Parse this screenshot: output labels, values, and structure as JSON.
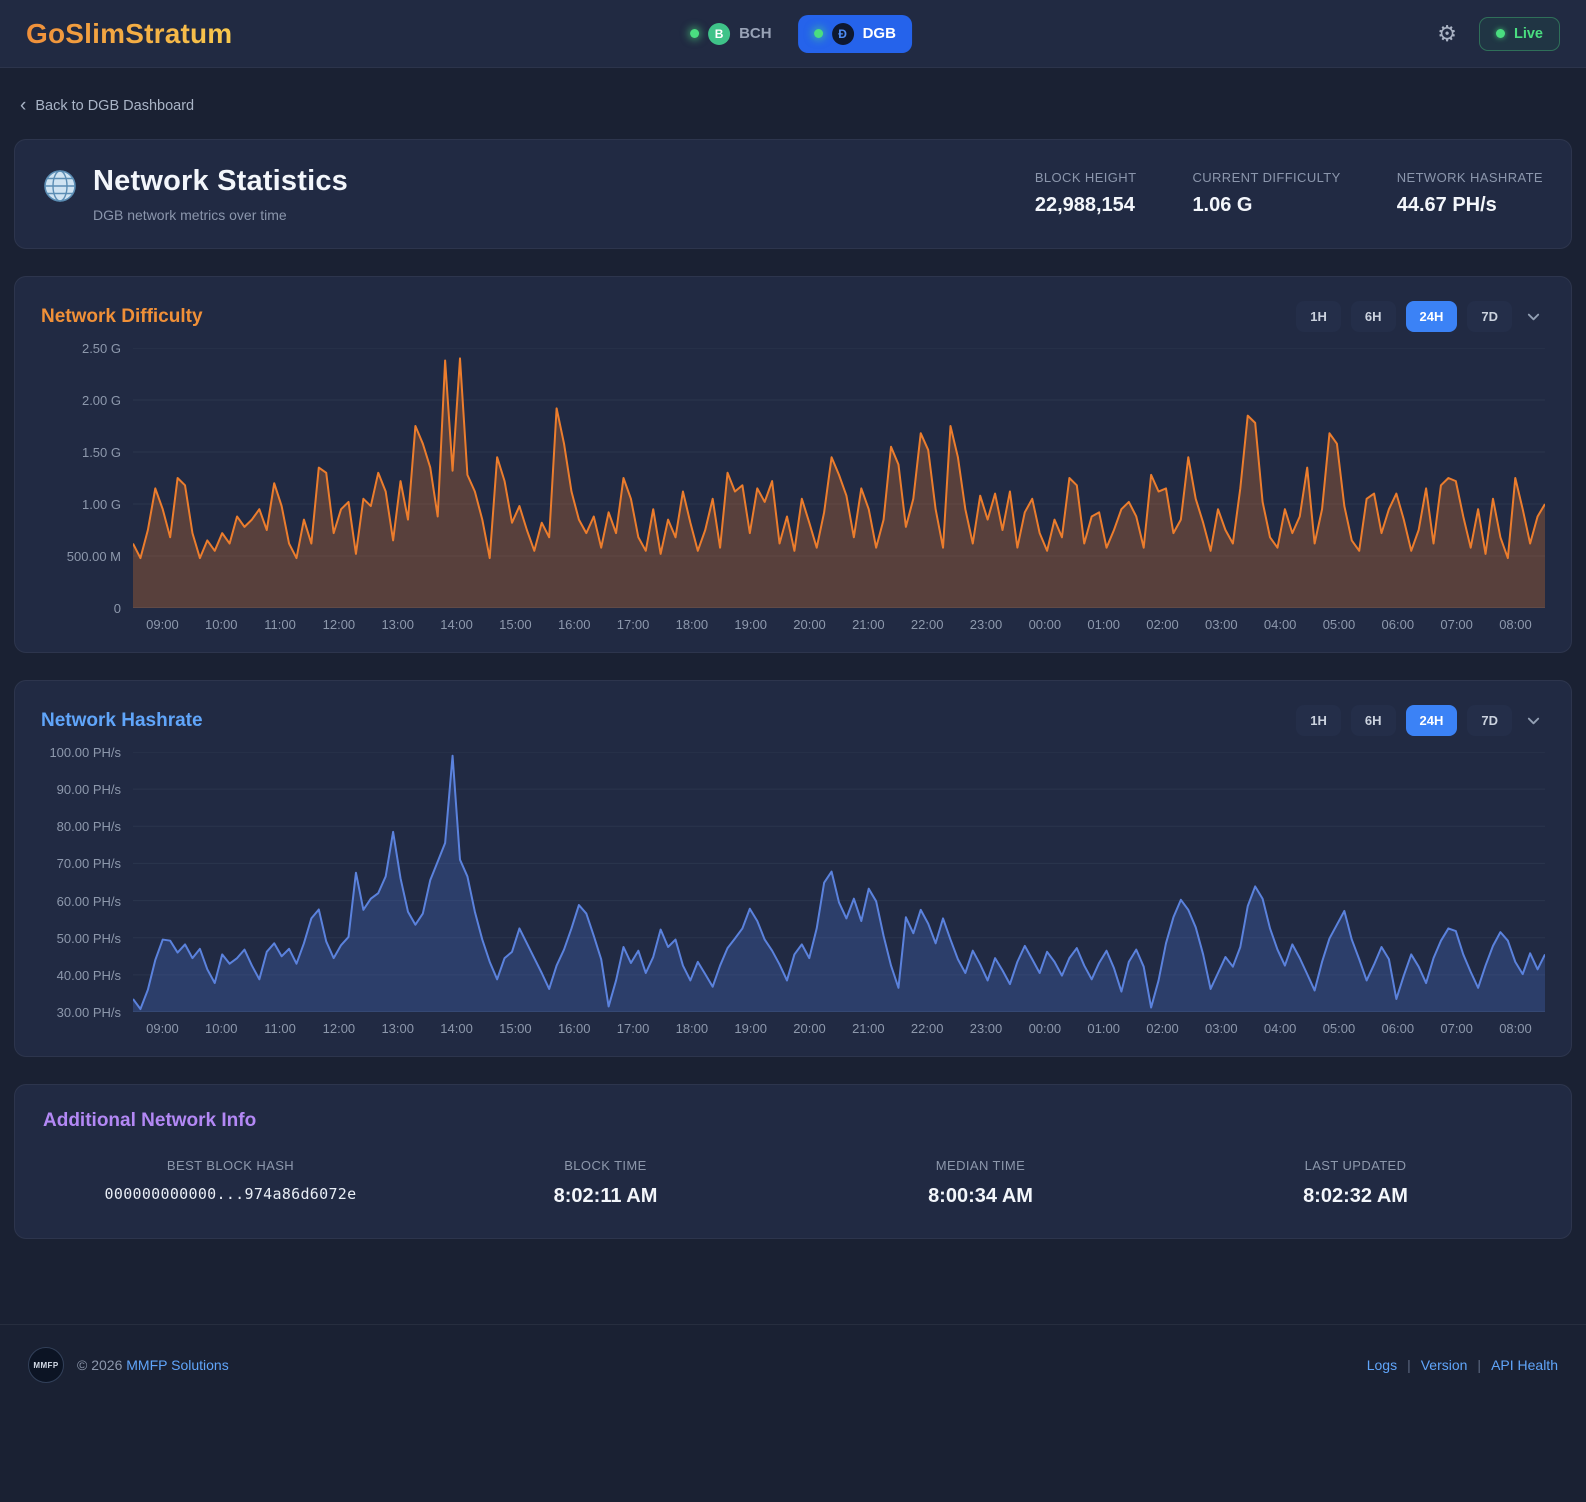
{
  "header": {
    "logo": "GoSlimStratum",
    "coins": [
      {
        "label": "BCH",
        "active": false
      },
      {
        "label": "DGB",
        "active": true
      }
    ],
    "live_label": "Live"
  },
  "breadcrumb": {
    "back_label": "Back to DGB Dashboard"
  },
  "stats_card": {
    "title": "Network Statistics",
    "subtitle": "DGB network metrics over time",
    "stats": [
      {
        "label": "BLOCK HEIGHT",
        "value": "22,988,154"
      },
      {
        "label": "CURRENT DIFFICULTY",
        "value": "1.06 G"
      },
      {
        "label": "NETWORK HASHRATE",
        "value": "44.67 PH/s"
      }
    ]
  },
  "time_ranges": [
    "1H",
    "6H",
    "24H",
    "7D"
  ],
  "active_range": "24H",
  "colors": {
    "accent_blue": "#3b82f6",
    "difficulty_orange": "#ec7d2d",
    "hashrate_blue": "#5b82dd",
    "live_green": "#4ade80",
    "purple": "#b388f5"
  },
  "chart_data": [
    {
      "id": "difficulty",
      "type": "area",
      "title": "Network Difficulty",
      "title_color": "#f09038",
      "line_color": "#ec7d2d",
      "fill_color": "rgba(236,125,45,0.27)",
      "ylabel_unit": "G",
      "ylim": [
        0,
        2.5
      ],
      "y_ticks": [
        {
          "v": 0,
          "label": "0"
        },
        {
          "v": 0.5,
          "label": "500.00 M"
        },
        {
          "v": 1,
          "label": "1.00 G"
        },
        {
          "v": 1.5,
          "label": "1.50 G"
        },
        {
          "v": 2,
          "label": "2.00 G"
        },
        {
          "v": 2.5,
          "label": "2.50 G"
        }
      ],
      "x_ticks": [
        "09:00",
        "10:00",
        "11:00",
        "12:00",
        "13:00",
        "14:00",
        "15:00",
        "16:00",
        "17:00",
        "18:00",
        "19:00",
        "20:00",
        "21:00",
        "22:00",
        "23:00",
        "00:00",
        "01:00",
        "02:00",
        "03:00",
        "04:00",
        "05:00",
        "06:00",
        "07:00",
        "08:00"
      ],
      "values": [
        0.62,
        0.48,
        0.75,
        1.15,
        0.95,
        0.68,
        1.25,
        1.18,
        0.72,
        0.48,
        0.65,
        0.55,
        0.72,
        0.62,
        0.88,
        0.78,
        0.85,
        0.95,
        0.75,
        1.2,
        0.98,
        0.62,
        0.48,
        0.85,
        0.62,
        1.35,
        1.3,
        0.72,
        0.95,
        1.02,
        0.52,
        1.05,
        0.98,
        1.3,
        1.12,
        0.65,
        1.22,
        0.85,
        1.75,
        1.58,
        1.35,
        0.88,
        2.38,
        1.32,
        2.4,
        1.28,
        1.12,
        0.85,
        0.48,
        1.45,
        1.22,
        0.82,
        0.98,
        0.75,
        0.55,
        0.82,
        0.68,
        1.92,
        1.58,
        1.12,
        0.85,
        0.72,
        0.88,
        0.58,
        0.92,
        0.72,
        1.25,
        1.05,
        0.68,
        0.55,
        0.95,
        0.52,
        0.85,
        0.68,
        1.12,
        0.82,
        0.55,
        0.75,
        1.05,
        0.58,
        1.3,
        1.12,
        1.18,
        0.72,
        1.15,
        1.02,
        1.22,
        0.62,
        0.88,
        0.55,
        1.05,
        0.82,
        0.58,
        0.92,
        1.45,
        1.28,
        1.08,
        0.68,
        1.15,
        0.95,
        0.58,
        0.85,
        1.55,
        1.38,
        0.78,
        1.05,
        1.68,
        1.52,
        0.95,
        0.58,
        1.75,
        1.45,
        0.95,
        0.62,
        1.08,
        0.85,
        1.1,
        0.75,
        1.12,
        0.58,
        0.92,
        1.05,
        0.72,
        0.55,
        0.85,
        0.68,
        1.25,
        1.18,
        0.62,
        0.88,
        0.92,
        0.58,
        0.75,
        0.95,
        1.02,
        0.88,
        0.58,
        1.28,
        1.12,
        1.15,
        0.72,
        0.85,
        1.45,
        1.05,
        0.82,
        0.55,
        0.95,
        0.75,
        0.62,
        1.15,
        1.85,
        1.78,
        1.02,
        0.68,
        0.58,
        0.95,
        0.72,
        0.88,
        1.35,
        0.62,
        0.95,
        1.68,
        1.58,
        0.98,
        0.65,
        0.55,
        1.05,
        1.1,
        0.72,
        0.95,
        1.1,
        0.85,
        0.55,
        0.75,
        1.15,
        0.62,
        1.18,
        1.25,
        1.22,
        0.88,
        0.58,
        0.95,
        0.52,
        1.05,
        0.68,
        0.48,
        1.25,
        0.95,
        0.62,
        0.88,
        1.0
      ]
    },
    {
      "id": "hashrate",
      "type": "area",
      "title": "Network Hashrate",
      "title_color": "#60a5fa",
      "line_color": "#5b82dd",
      "fill_color": "rgba(75,114,209,0.28)",
      "ylabel_unit": "PH/s",
      "ylim": [
        30,
        100
      ],
      "y_ticks": [
        {
          "v": 30,
          "label": "30.00 PH/s"
        },
        {
          "v": 40,
          "label": "40.00 PH/s"
        },
        {
          "v": 50,
          "label": "50.00 PH/s"
        },
        {
          "v": 60,
          "label": "60.00 PH/s"
        },
        {
          "v": 70,
          "label": "70.00 PH/s"
        },
        {
          "v": 80,
          "label": "80.00 PH/s"
        },
        {
          "v": 90,
          "label": "90.00 PH/s"
        },
        {
          "v": 100,
          "label": "100.00 PH/s"
        }
      ],
      "x_ticks": [
        "09:00",
        "10:00",
        "11:00",
        "12:00",
        "13:00",
        "14:00",
        "15:00",
        "16:00",
        "17:00",
        "18:00",
        "19:00",
        "20:00",
        "21:00",
        "22:00",
        "23:00",
        "00:00",
        "01:00",
        "02:00",
        "03:00",
        "04:00",
        "05:00",
        "06:00",
        "07:00",
        "08:00"
      ],
      "values": [
        33.5,
        30.8,
        36,
        44,
        49.5,
        49.2,
        46,
        48.2,
        44.5,
        47,
        41.5,
        37.8,
        45.5,
        43,
        44.5,
        46.8,
        42.5,
        38.8,
        46.2,
        48.5,
        45,
        47,
        43,
        48.5,
        55.2,
        57.6,
        49,
        44.5,
        48,
        50.2,
        67.5,
        57.5,
        60.5,
        62,
        66.5,
        78.5,
        66,
        57,
        53.5,
        56.5,
        65.5,
        70.5,
        75.5,
        99,
        71,
        66.5,
        57,
        49.5,
        43.5,
        38.8,
        44.5,
        46.2,
        52.5,
        48.5,
        44.5,
        40.5,
        36.2,
        42.5,
        46.8,
        52.5,
        58.8,
        56.5,
        50.5,
        44.2,
        31.5,
        38.5,
        47.5,
        43.2,
        46.5,
        40.5,
        44.8,
        52.2,
        47.5,
        49.5,
        42.5,
        38.5,
        43.5,
        40.2,
        36.8,
        42.5,
        47.2,
        49.8,
        52.5,
        57.8,
        54.5,
        49.5,
        46.5,
        42.8,
        38.5,
        45.5,
        48.2,
        44.5,
        52.5,
        64.8,
        67.8,
        59.5,
        55.2,
        60.5,
        54.5,
        63.2,
        59.8,
        50.5,
        42.5,
        36.5,
        55.5,
        51.2,
        57.5,
        53.8,
        48.5,
        55.2,
        49.5,
        44.2,
        40.5,
        46.5,
        42.8,
        38.5,
        44.5,
        41.2,
        37.5,
        43.5,
        47.8,
        44.2,
        40.5,
        46.2,
        43.5,
        39.8,
        44.5,
        47.2,
        42.5,
        38.8,
        43.2,
        46.5,
        41.8,
        35.5,
        43.5,
        46.8,
        42.2,
        31.2,
        38.5,
        48.5,
        55.5,
        60.2,
        57.5,
        52.8,
        45.5,
        36.2,
        40.5,
        44.8,
        42.2,
        47.5,
        58.5,
        63.8,
        60.5,
        52.5,
        46.8,
        42.5,
        48.2,
        44.5,
        40.2,
        35.8,
        43.5,
        49.8,
        53.5,
        57.2,
        49.5,
        44.2,
        38.5,
        42.8,
        47.5,
        44.2,
        33.5,
        39.8,
        45.5,
        42.2,
        37.8,
        44.5,
        49.2,
        52.5,
        51.8,
        45.5,
        40.8,
        36.5,
        42.5,
        47.8,
        51.5,
        49.2,
        43.5,
        40.2,
        45.8,
        41.5,
        45.5
      ]
    }
  ],
  "info_card": {
    "title": "Additional Network Info",
    "items": [
      {
        "label": "BEST BLOCK HASH",
        "value": "000000000000...974a86d6072e",
        "mono": true
      },
      {
        "label": "BLOCK TIME",
        "value": "8:02:11 AM",
        "mono": false
      },
      {
        "label": "MEDIAN TIME",
        "value": "8:00:34 AM",
        "mono": false
      },
      {
        "label": "LAST UPDATED",
        "value": "8:02:32 AM",
        "mono": false
      }
    ]
  },
  "footer": {
    "logo_text": "MMFP",
    "copyright": "© 2026",
    "company": "MMFP Solutions",
    "links": [
      "Logs",
      "Version",
      "API Health"
    ]
  }
}
